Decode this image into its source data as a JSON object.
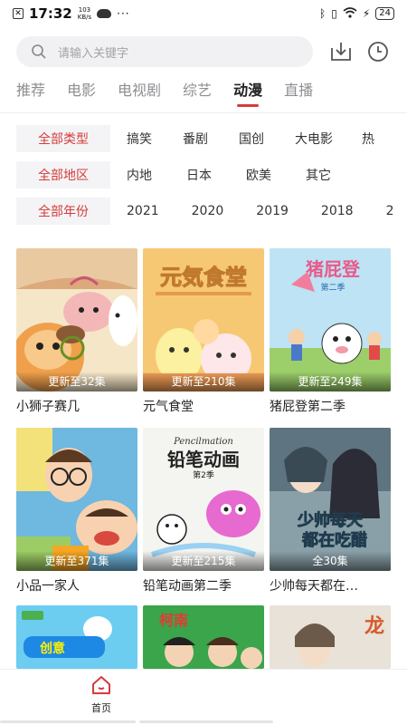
{
  "status_bar": {
    "time": "17:32",
    "speed_value": "103",
    "speed_unit": "KB/s",
    "battery": "24"
  },
  "search": {
    "placeholder": "请输入关键字",
    "icon": "search-icon",
    "download_icon": "download-icon",
    "history_icon": "clock-icon"
  },
  "tabs": [
    {
      "label": "推荐",
      "active": false
    },
    {
      "label": "电影",
      "active": false
    },
    {
      "label": "电视剧",
      "active": false
    },
    {
      "label": "综艺",
      "active": false
    },
    {
      "label": "动漫",
      "active": true
    },
    {
      "label": "直播",
      "active": false
    }
  ],
  "filters": {
    "type": {
      "title": "全部类型",
      "options": [
        "搞笑",
        "番剧",
        "国创",
        "大电影",
        "热"
      ]
    },
    "region": {
      "title": "全部地区",
      "options": [
        "内地",
        "日本",
        "欧美",
        "其它"
      ]
    },
    "year": {
      "title": "全部年份",
      "options": [
        "2021",
        "2020",
        "2019",
        "2018",
        "2"
      ]
    }
  },
  "cards": [
    {
      "title": "小狮子赛几",
      "episodes": "更新至32集"
    },
    {
      "title": "元气食堂",
      "episodes": "更新至210集"
    },
    {
      "title": "猪屁登第二季",
      "episodes": "更新至249集"
    },
    {
      "title": "小品一家人",
      "episodes": "更新至371集"
    },
    {
      "title": "铅笔动画第二季",
      "episodes": "更新至215集"
    },
    {
      "title": "少帅每天都在…",
      "episodes": "全30集"
    }
  ],
  "poster_texts": {
    "p2": "元気食堂",
    "p3": "猪屁登",
    "p3_sub": "第二季",
    "p5_en": "Pencilmation",
    "p5": "铅笔动画",
    "p5_sub": "第2季",
    "p6_a": "少帅每天",
    "p6_b": "都在吃醋",
    "p7": "创意",
    "p8": "柯南",
    "p9": "龙"
  },
  "bottom_nav": {
    "home_label": "首页"
  },
  "colors": {
    "accent": "#d63b3b",
    "filter_bg": "#f4f4f6",
    "search_bg": "#f1f1f3"
  }
}
